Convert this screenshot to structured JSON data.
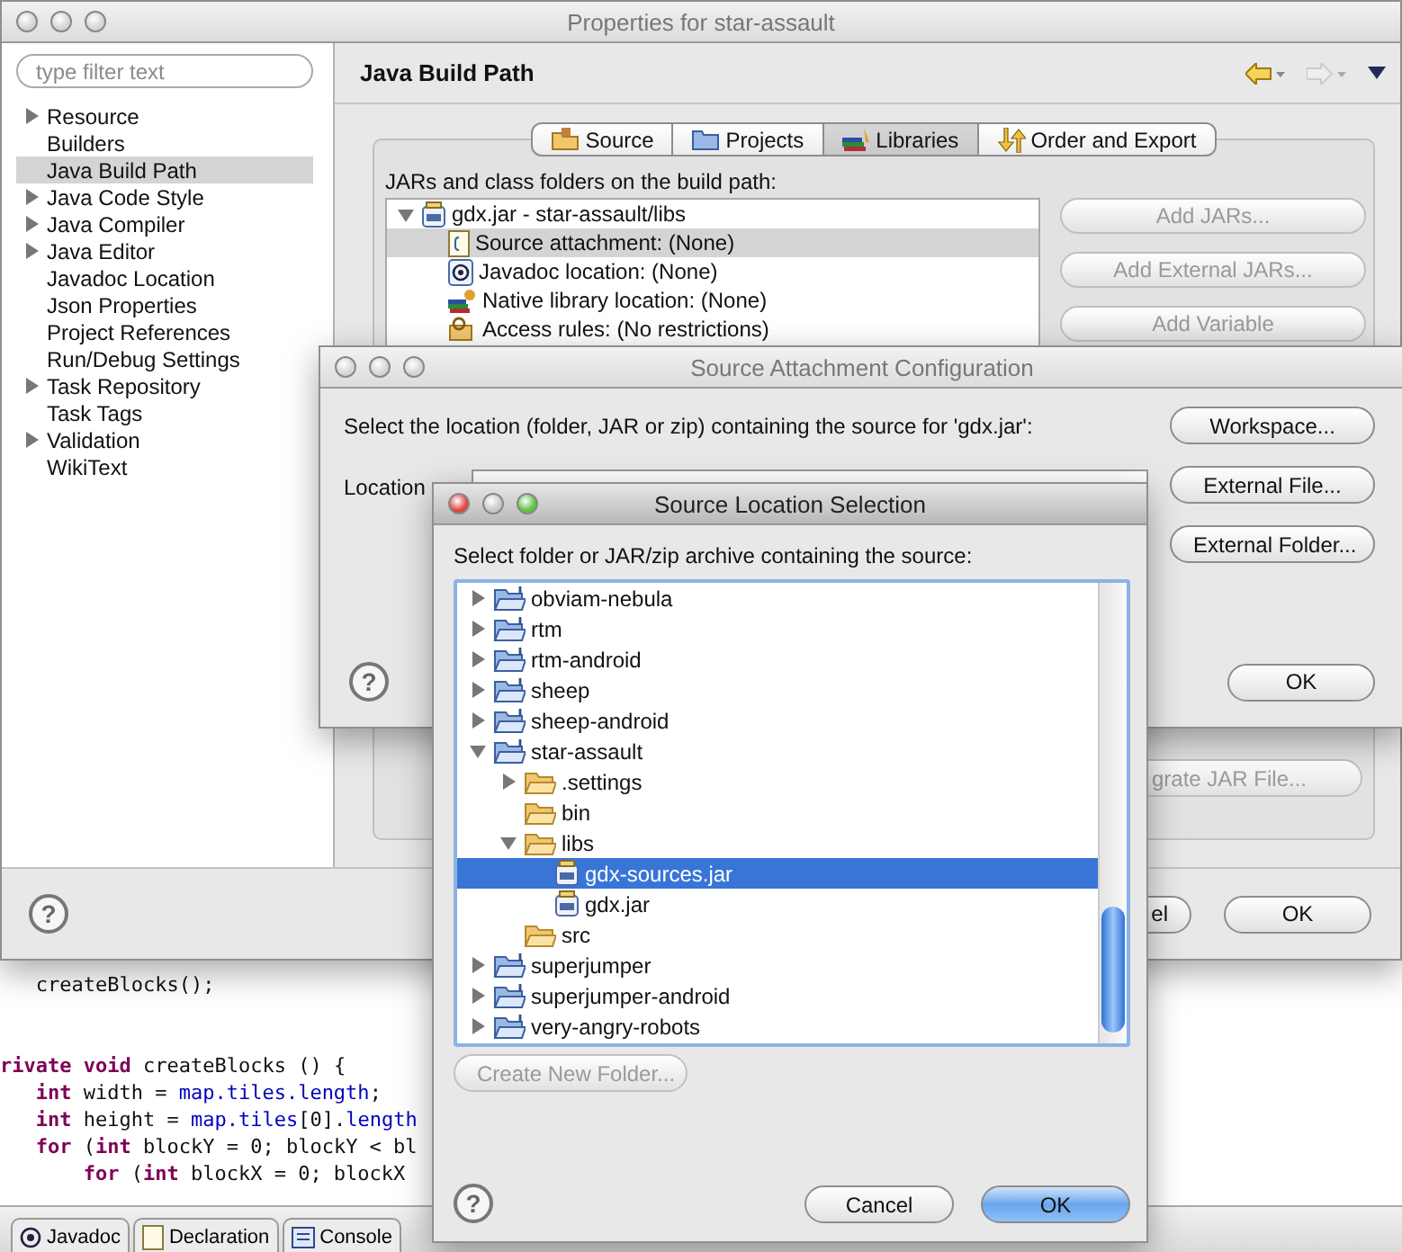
{
  "properties_window": {
    "title": "Properties for star-assault",
    "active": false,
    "filter": {
      "placeholder": "type filter text"
    },
    "sidebar": {
      "items": [
        {
          "label": "Resource",
          "expandable": true,
          "selected": false
        },
        {
          "label": "Builders",
          "expandable": false,
          "selected": false
        },
        {
          "label": "Java Build Path",
          "expandable": false,
          "selected": true
        },
        {
          "label": "Java Code Style",
          "expandable": true,
          "selected": false
        },
        {
          "label": "Java Compiler",
          "expandable": true,
          "selected": false
        },
        {
          "label": "Java Editor",
          "expandable": true,
          "selected": false
        },
        {
          "label": "Javadoc Location",
          "expandable": false,
          "selected": false
        },
        {
          "label": "Json Properties",
          "expandable": false,
          "selected": false
        },
        {
          "label": "Project References",
          "expandable": false,
          "selected": false
        },
        {
          "label": "Run/Debug Settings",
          "expandable": false,
          "selected": false
        },
        {
          "label": "Task Repository",
          "expandable": true,
          "selected": false
        },
        {
          "label": "Task Tags",
          "expandable": false,
          "selected": false
        },
        {
          "label": "Validation",
          "expandable": true,
          "selected": false
        },
        {
          "label": "WikiText",
          "expandable": false,
          "selected": false
        }
      ]
    },
    "page_title": "Java Build Path",
    "tabs": [
      {
        "label": "Source",
        "kind": "source",
        "selected": false
      },
      {
        "label": "Projects",
        "kind": "projects",
        "selected": false
      },
      {
        "label": "Libraries",
        "kind": "libraries",
        "selected": true
      },
      {
        "label": "Order and Export",
        "kind": "order",
        "selected": false
      }
    ],
    "list_label": "JARs and class folders on the build path:",
    "build_path_tree": [
      {
        "label": "gdx.jar - star-assault/libs",
        "kind": "jar",
        "expanded": true,
        "selected": false,
        "children": [
          {
            "label": "Source attachment: (None)",
            "kind": "source",
            "selected": true
          },
          {
            "label": "Javadoc location: (None)",
            "kind": "javadoc",
            "selected": false
          },
          {
            "label": "Native library location: (None)",
            "kind": "native",
            "selected": false
          },
          {
            "label": "Access rules: (No restrictions)",
            "kind": "access",
            "selected": false
          }
        ]
      }
    ],
    "side_buttons": [
      {
        "label": "Add JARs...",
        "disabled": true
      },
      {
        "label": "Add External JARs...",
        "disabled": true
      },
      {
        "label": "Add Variable",
        "disabled": true
      }
    ],
    "lower_button": {
      "label": "grate JAR File...",
      "disabled": true
    },
    "help": "?",
    "footer_buttons": [
      {
        "label": "el"
      },
      {
        "label": "OK"
      }
    ]
  },
  "editor": {
    "code_blocks": [
      [
        {
          "children": [
            {
              "segments": [
                {
                  "kind": "plain",
                  "text": "createBlocks();"
                }
              ]
            }
          ]
        }
      ],
      [
        {
          "segments": [
            {
              "kind": "keyword",
              "text": "rivate"
            },
            {
              "kind": "keyword",
              "text": " void"
            },
            {
              "kind": "plain",
              "text": " createBlocks () {"
            }
          ],
          "children": [
            {
              "segments": [
                {
                  "kind": "keyword",
                  "text": "int"
                },
                {
                  "kind": "plain",
                  "text": " width = "
                },
                {
                  "kind": "field",
                  "text": "map.tiles.length"
                },
                {
                  "kind": "plain",
                  "text": ";"
                }
              ]
            },
            {
              "segments": [
                {
                  "kind": "keyword",
                  "text": "int"
                },
                {
                  "kind": "plain",
                  "text": " height = "
                },
                {
                  "kind": "field",
                  "text": "map.tiles"
                },
                {
                  "kind": "plain",
                  "text": "[0]."
                },
                {
                  "kind": "field",
                  "text": "length"
                }
              ]
            },
            {
              "segments": [
                {
                  "kind": "keyword",
                  "text": "for"
                },
                {
                  "kind": "plain",
                  "text": " ("
                },
                {
                  "kind": "keyword",
                  "text": "int"
                },
                {
                  "kind": "plain",
                  "text": " blockY = 0; blockY < bl"
                }
              ],
              "children": [
                {
                  "segments": [
                    {
                      "kind": "keyword",
                      "text": "for"
                    },
                    {
                      "kind": "plain",
                      "text": " ("
                    },
                    {
                      "kind": "keyword",
                      "text": "int"
                    },
                    {
                      "kind": "plain",
                      "text": " blockX = 0; blockX"
                    }
                  ]
                }
              ]
            }
          ]
        }
      ]
    ],
    "bottom_tabs": [
      {
        "label": "Javadoc",
        "kind": "javadoc"
      },
      {
        "label": "Declaration",
        "kind": "declaration"
      },
      {
        "label": "Console",
        "kind": "console"
      }
    ]
  },
  "attach_dialog": {
    "title": "Source Attachment Configuration",
    "active": false,
    "prompt": "Select the location (folder, JAR or zip) containing the source for 'gdx.jar':",
    "location_label": "Location",
    "buttons": [
      {
        "label": "Workspace..."
      },
      {
        "label": "External File..."
      },
      {
        "label": "External Folder..."
      }
    ],
    "help": "?",
    "footer_buttons": [
      {
        "label": "OK"
      }
    ]
  },
  "selection_dialog": {
    "title": "Source Location Selection",
    "active": true,
    "prompt": "Select folder or JAR/zip archive containing the source:",
    "tree": [
      {
        "label": "obviam-nebula",
        "kind": "project",
        "expanded": false,
        "selected": false
      },
      {
        "label": "rtm",
        "kind": "project",
        "expanded": false,
        "selected": false
      },
      {
        "label": "rtm-android",
        "kind": "project",
        "expanded": false,
        "selected": false
      },
      {
        "label": "sheep",
        "kind": "project",
        "expanded": false,
        "selected": false
      },
      {
        "label": "sheep-android",
        "kind": "project",
        "expanded": false,
        "selected": false
      },
      {
        "label": "star-assault",
        "kind": "project",
        "expanded": true,
        "selected": false,
        "children": [
          {
            "label": ".settings",
            "kind": "folder",
            "expanded": false,
            "selected": false
          },
          {
            "label": "bin",
            "kind": "folder",
            "selected": false
          },
          {
            "label": "libs",
            "kind": "folder",
            "expanded": true,
            "selected": false,
            "children": [
              {
                "label": "gdx-sources.jar",
                "kind": "jar",
                "selected": true
              },
              {
                "label": "gdx.jar",
                "kind": "jar",
                "selected": false
              }
            ]
          },
          {
            "label": "src",
            "kind": "folder",
            "selected": false
          }
        ]
      },
      {
        "label": "superjumper",
        "kind": "project",
        "expanded": false,
        "selected": false
      },
      {
        "label": "superjumper-android",
        "kind": "project",
        "expanded": false,
        "selected": false
      },
      {
        "label": "very-angry-robots",
        "kind": "project",
        "expanded": false,
        "selected": false
      }
    ],
    "create_button": {
      "label": "Create New Folder...",
      "disabled": true
    },
    "help": "?",
    "buttons": [
      {
        "label": "Cancel",
        "default": false
      },
      {
        "label": "OK",
        "default": true
      }
    ]
  }
}
